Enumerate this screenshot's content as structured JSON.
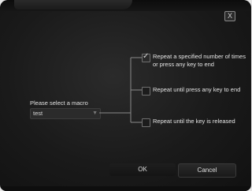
{
  "dialog": {
    "close_glyph": "X",
    "close_icon": "close-icon"
  },
  "macro": {
    "label": "Please select a macro",
    "selected": "test",
    "dropdown_icon": "chevron-down-icon"
  },
  "options": [
    {
      "label": "Repeat a specified number of times or press any key to end",
      "checked": true
    },
    {
      "label": "Repeat until press any key to end",
      "checked": false
    },
    {
      "label": "Repeat until the key is released",
      "checked": false
    }
  ],
  "buttons": {
    "ok": "OK",
    "cancel": "Cancel"
  },
  "colors": {
    "background": "#1a1a1a",
    "text": "#e6e6e6",
    "bracket": "#8a8a8a"
  }
}
